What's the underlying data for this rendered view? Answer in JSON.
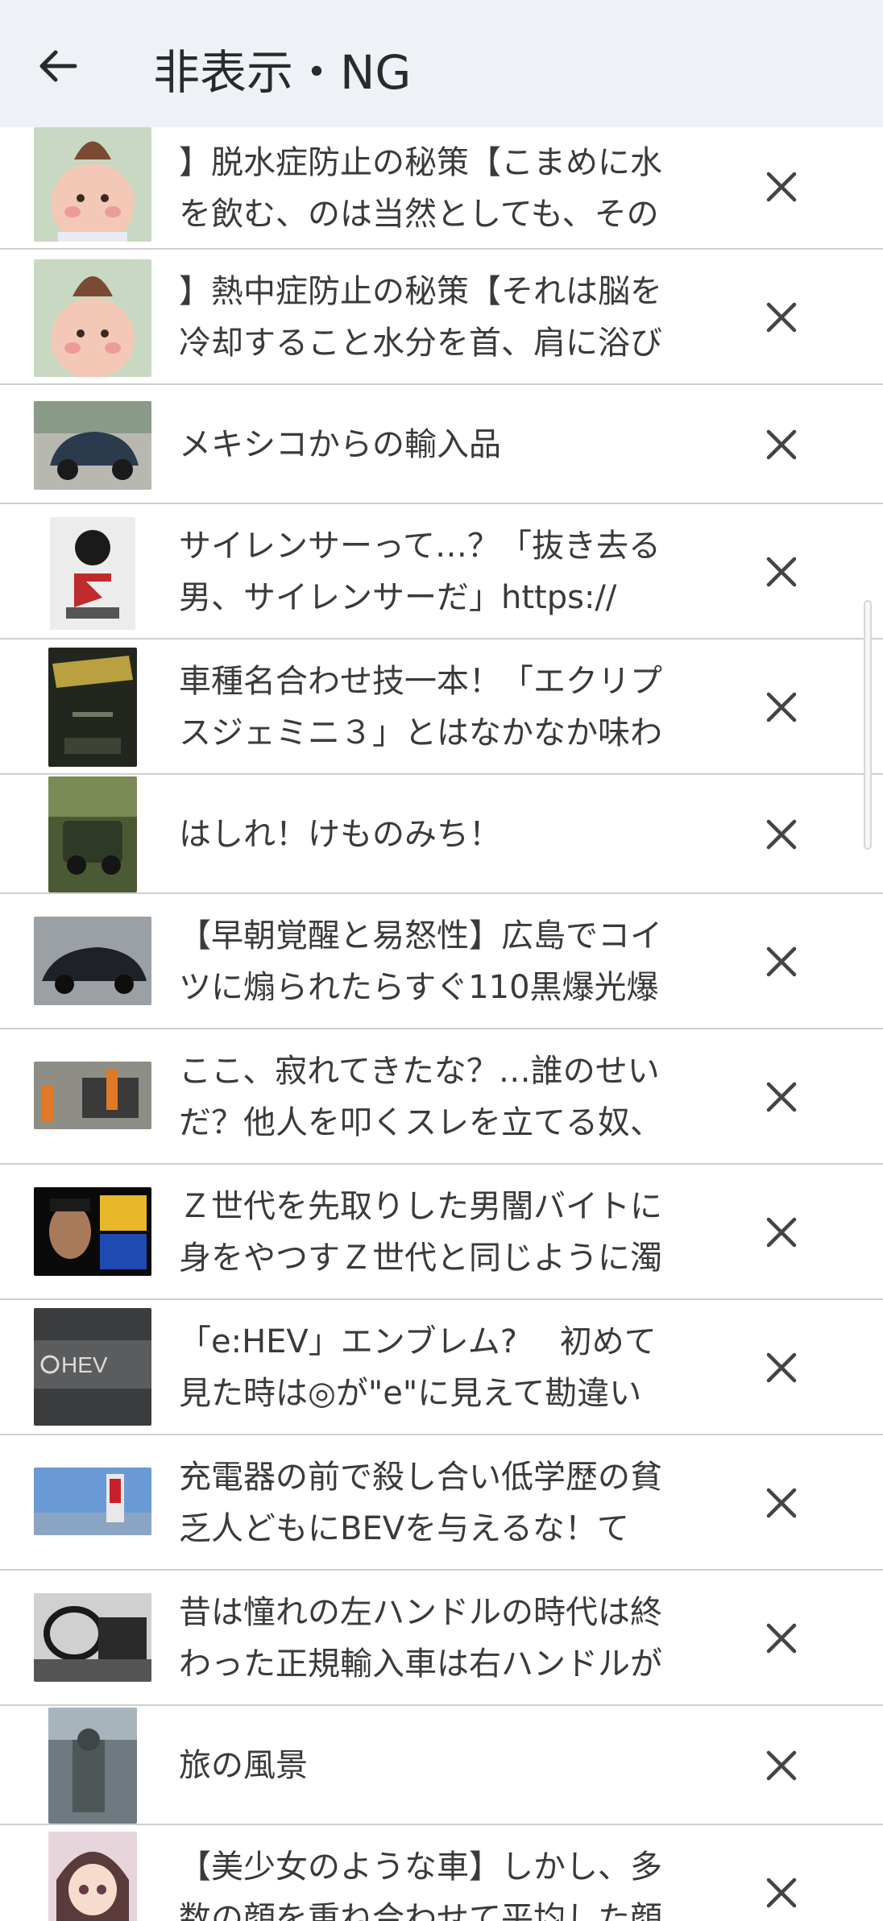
{
  "header": {
    "title": "非表示・NG",
    "back_icon": "arrow-left-icon"
  },
  "colors": {
    "appbar_bg": "#eef1f6",
    "divider": "#cfcfcf",
    "text": "#3a3a3a",
    "icon": "#444444"
  },
  "items": [
    {
      "text": "】脱水症防止の秘策【こまめに水\nを飲む、のは当然としても、その",
      "thumb": "chubby-child-photo",
      "remove_icon": "close-icon"
    },
    {
      "text": "】熱中症防止の秘策【それは脳を\n冷却すること水分を首、肩に浴び",
      "thumb": "chubby-child-photo",
      "remove_icon": "close-icon"
    },
    {
      "text": "メキシコからの輸入品",
      "thumb": "classic-car-photo",
      "remove_icon": "close-icon"
    },
    {
      "text": "サイレンサーって…？「抜き去る\n男、サイレンサーだ」https://",
      "thumb": "magazine-cover-photo",
      "remove_icon": "close-icon"
    },
    {
      "text": "車種名合わせ技一本！「エクリプ\nスジェミニ３」とはなかなか味わ",
      "thumb": "book-cover-photo",
      "remove_icon": "close-icon"
    },
    {
      "text": "はしれ！けものみち！",
      "thumb": "offroad-car-photo",
      "remove_icon": "close-icon"
    },
    {
      "text": "【早朝覚醒と易怒性】広島でコイ\nツに煽られたらすぐ110黒爆光爆",
      "thumb": "dark-sedan-photo",
      "remove_icon": "close-icon"
    },
    {
      "text": "ここ、寂れてきたな？…誰のせい\nだ？他人を叩くスレを立てる奴、",
      "thumb": "accident-scene-photo",
      "remove_icon": "close-icon"
    },
    {
      "text": "Ｚ世代を先取りした男闇バイトに\n身をやつすＺ世代と同じように濁",
      "thumb": "portrait-news-photo",
      "remove_icon": "close-icon"
    },
    {
      "text": "「e:HEV」エンブレム?　 初めて\n見た時は◎が\"e\"に見えて勘違い",
      "thumb": "hev-emblem-photo",
      "remove_icon": "close-icon"
    },
    {
      "text": "充電器の前で殺し合い低学歴の貧\n乏人どもにBEVを与えるな！て",
      "thumb": "charger-station-photo",
      "remove_icon": "close-icon"
    },
    {
      "text": "昔は憧れの左ハンドルの時代は終\nわった正規輸入車は右ハンドルが",
      "thumb": "car-interior-photo",
      "remove_icon": "close-icon"
    },
    {
      "text": "旅の風景",
      "thumb": "street-scene-photo",
      "remove_icon": "close-icon"
    },
    {
      "text": "【美少女のような車】しかし、多\n数の顔を重ね合わせて平均した顔",
      "thumb": "anime-girl-photo",
      "remove_icon": "close-icon"
    }
  ]
}
